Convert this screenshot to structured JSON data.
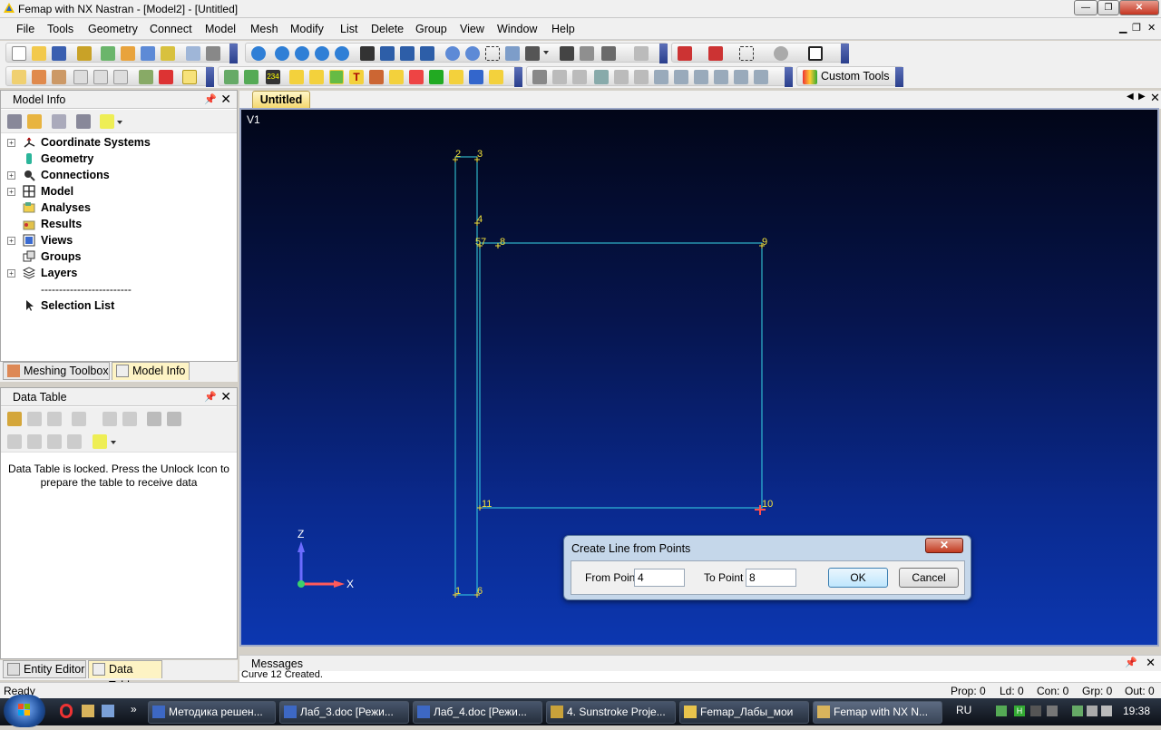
{
  "window": {
    "title": "Femap with NX Nastran - [Model2] - [Untitled]",
    "min": "—",
    "max": "❐",
    "close": "✕"
  },
  "menu": [
    "File",
    "Tools",
    "Geometry",
    "Connect",
    "Model",
    "Mesh",
    "Modify",
    "List",
    "Delete",
    "Group",
    "View",
    "Window",
    "Help"
  ],
  "toolbar": {
    "custom_tools": "Custom Tools"
  },
  "model_info": {
    "title": "Model Info",
    "items": [
      {
        "label": "Coordinate Systems",
        "icon": "coordinate-systems-icon",
        "expandable": true
      },
      {
        "label": "Geometry",
        "icon": "geometry-icon",
        "expandable": false
      },
      {
        "label": "Connections",
        "icon": "connections-icon",
        "expandable": true
      },
      {
        "label": "Model",
        "icon": "model-icon",
        "expandable": true
      },
      {
        "label": "Analyses",
        "icon": "analyses-icon",
        "expandable": false
      },
      {
        "label": "Results",
        "icon": "results-icon",
        "expandable": false
      },
      {
        "label": "Views",
        "icon": "views-icon",
        "expandable": true
      },
      {
        "label": "Groups",
        "icon": "groups-icon",
        "expandable": false
      },
      {
        "label": "Layers",
        "icon": "layers-icon",
        "expandable": true
      }
    ],
    "separator": "-------------------------",
    "selection_list": "Selection List"
  },
  "left_tabs": [
    "Meshing Toolbox",
    "Model Info"
  ],
  "data_table": {
    "title": "Data Table",
    "locked_message": "Data Table is locked. Press the Unlock Icon to prepare the table to receive data"
  },
  "bottom_tabs": [
    "Entity Editor",
    "Data Table"
  ],
  "doc_tab": "Untitled",
  "viewport": {
    "view_label": "V1",
    "axis_labels": {
      "z": "Z",
      "x": "X"
    },
    "point_labels": [
      "1",
      "2",
      "3",
      "4",
      "5",
      "6",
      "7",
      "8",
      "9",
      "10",
      "11"
    ]
  },
  "dialog": {
    "title": "Create Line from Points",
    "from_label": "From Point",
    "from_value": "4",
    "to_label": "To Point",
    "to_value": "8",
    "ok": "OK",
    "cancel": "Cancel",
    "close": "✕"
  },
  "messages": {
    "title": "Messages",
    "last_line": "Curve 12 Created."
  },
  "status": {
    "ready": "Ready",
    "prop": "Prop: 0",
    "ld": "Ld: 0",
    "con": "Con: 0",
    "grp": "Grp: 0",
    "out": "Out: 0"
  },
  "taskbar": {
    "tasks": [
      {
        "label": "Методика решен...",
        "icon": "word-doc-icon",
        "active": false
      },
      {
        "label": "Лаб_3.doc [Режи...",
        "icon": "word-doc-icon",
        "active": false
      },
      {
        "label": "Лаб_4.doc [Режи...",
        "icon": "word-doc-icon",
        "active": false
      },
      {
        "label": "4. Sunstroke Proje...",
        "icon": "media-player-icon",
        "active": false
      },
      {
        "label": "Femap_Лабы_мои",
        "icon": "folder-icon",
        "active": false
      },
      {
        "label": "Femap with NX N...",
        "icon": "femap-icon",
        "active": true
      }
    ],
    "lang": "RU",
    "clock": "19:38"
  }
}
